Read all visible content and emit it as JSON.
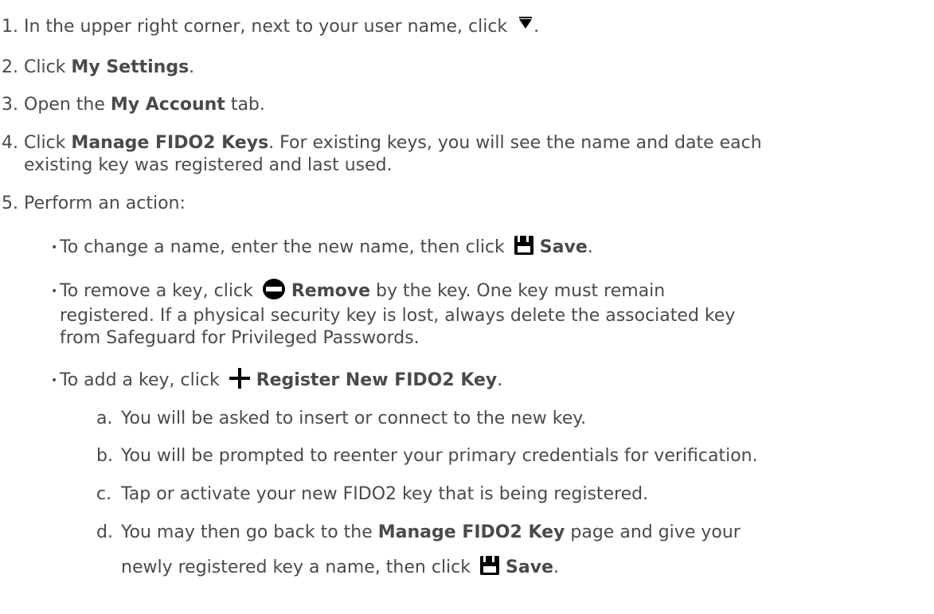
{
  "steps": [
    {
      "num": "1.",
      "text_before": "In the upper right corner, next to your user name, click",
      "text_after": "."
    },
    {
      "num": "2.",
      "text_before": "Click ",
      "bold": "My Settings",
      "text_after": "."
    },
    {
      "num": "3.",
      "text_before": "Open the ",
      "bold": "My Account",
      "text_after": " tab."
    },
    {
      "num": "4.",
      "text_before": "Click ",
      "bold": "Manage FIDO2 Keys",
      "text_after": ". For existing keys, you will see the name and date each",
      "line2": "existing key was registered and last used."
    },
    {
      "num": "5.",
      "text_before": "Perform an action:"
    }
  ],
  "bullets": [
    {
      "text_before": "To change a name, enter the new name, then click",
      "icon": "save-icon",
      "bold": "Save",
      "text_after": "."
    },
    {
      "text_before": "To remove a key, click",
      "icon": "remove-icon",
      "bold": "Remove",
      "text_after": " by the key. One key must remain",
      "line2": "registered. If a physical security key is lost, always delete the associated key",
      "line3": "from Safeguard for Privileged Passwords."
    },
    {
      "text_before": "To add a key, click",
      "icon": "plus-icon",
      "bold": "Register New FIDO2 Key",
      "text_after": "."
    }
  ],
  "substeps": [
    {
      "letter": "a.",
      "text": "You will be asked to insert or connect to the new key."
    },
    {
      "letter": "b.",
      "text": "You will be prompted to reenter your primary credentials for verification."
    },
    {
      "letter": "c.",
      "text": "Tap or activate your new FIDO2 key that is being registered."
    },
    {
      "letter": "d.",
      "text_before": "You may then go back to the ",
      "bold": "Manage FIDO2 Key",
      "text_after": " page and give your",
      "line2_before": "newly registered key a name, then click",
      "icon": "save-icon",
      "bold2": "Save",
      "line2_after": "."
    }
  ],
  "bullet_glyph": "•",
  "colors": {
    "text": "#4a4a4a",
    "icon": "#000000"
  }
}
